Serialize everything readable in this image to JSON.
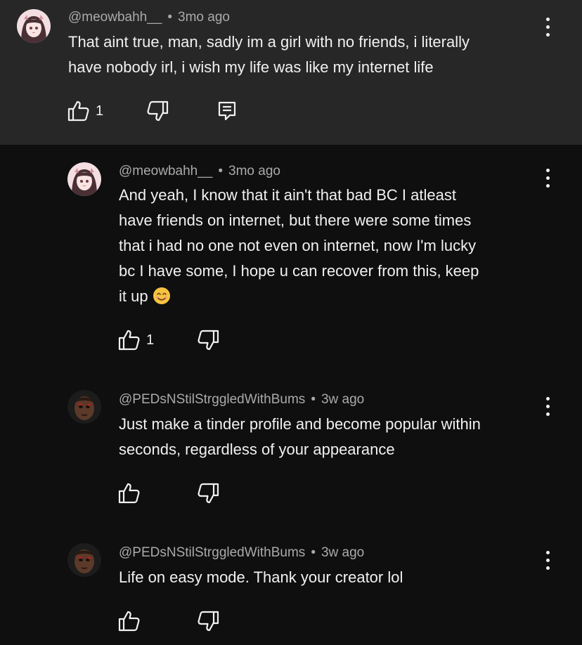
{
  "comments": [
    {
      "author": "@meowbahh__",
      "separator": "•",
      "time": "3mo ago",
      "text": "That aint true, man, sadly im a girl with no friends, i literally\nhave nobody irl, i wish my life was like my internet life",
      "likes": "1",
      "avatar": "anime-girl-avatar"
    },
    {
      "author": "@meowbahh__",
      "separator": "•",
      "time": "3mo ago",
      "text": "And yeah, I know that it ain't that bad BC I atleast\nhave friends on internet, but there were some times\nthat i had no one not even on internet, now I'm lucky\nbc I have some, I hope u can recover from this, keep\nit up",
      "emoji": "smiling-face-emoji",
      "likes": "1",
      "avatar": "anime-girl-avatar"
    },
    {
      "author": "@PEDsNStilStrggledWithBums",
      "separator": "•",
      "time": "3w ago",
      "text": "Just make a tinder profile and become popular within\nseconds, regardless of your appearance",
      "avatar": "fighter-face-avatar"
    },
    {
      "author": "@PEDsNStilStrggledWithBums",
      "separator": "•",
      "time": "3w ago",
      "text": "Life on easy mode. Thank your creator lol",
      "avatar": "fighter-face-avatar"
    }
  ]
}
